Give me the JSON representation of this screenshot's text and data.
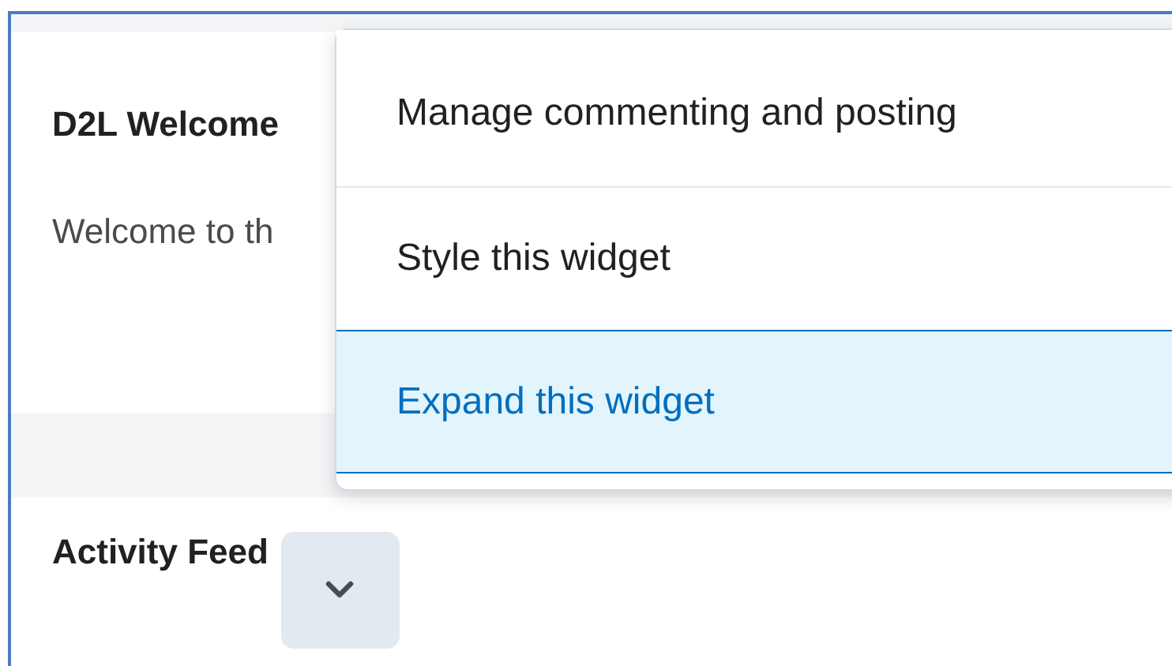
{
  "widgets": [
    {
      "title": "D2L Welcome",
      "body": "Welcome to th"
    },
    {
      "title": "Activity Feed"
    }
  ],
  "menu": {
    "items": [
      {
        "label": "Manage commenting and posting",
        "selected": false
      },
      {
        "label": "Style this widget",
        "selected": false
      },
      {
        "label": "Expand this widget",
        "selected": true
      }
    ]
  }
}
